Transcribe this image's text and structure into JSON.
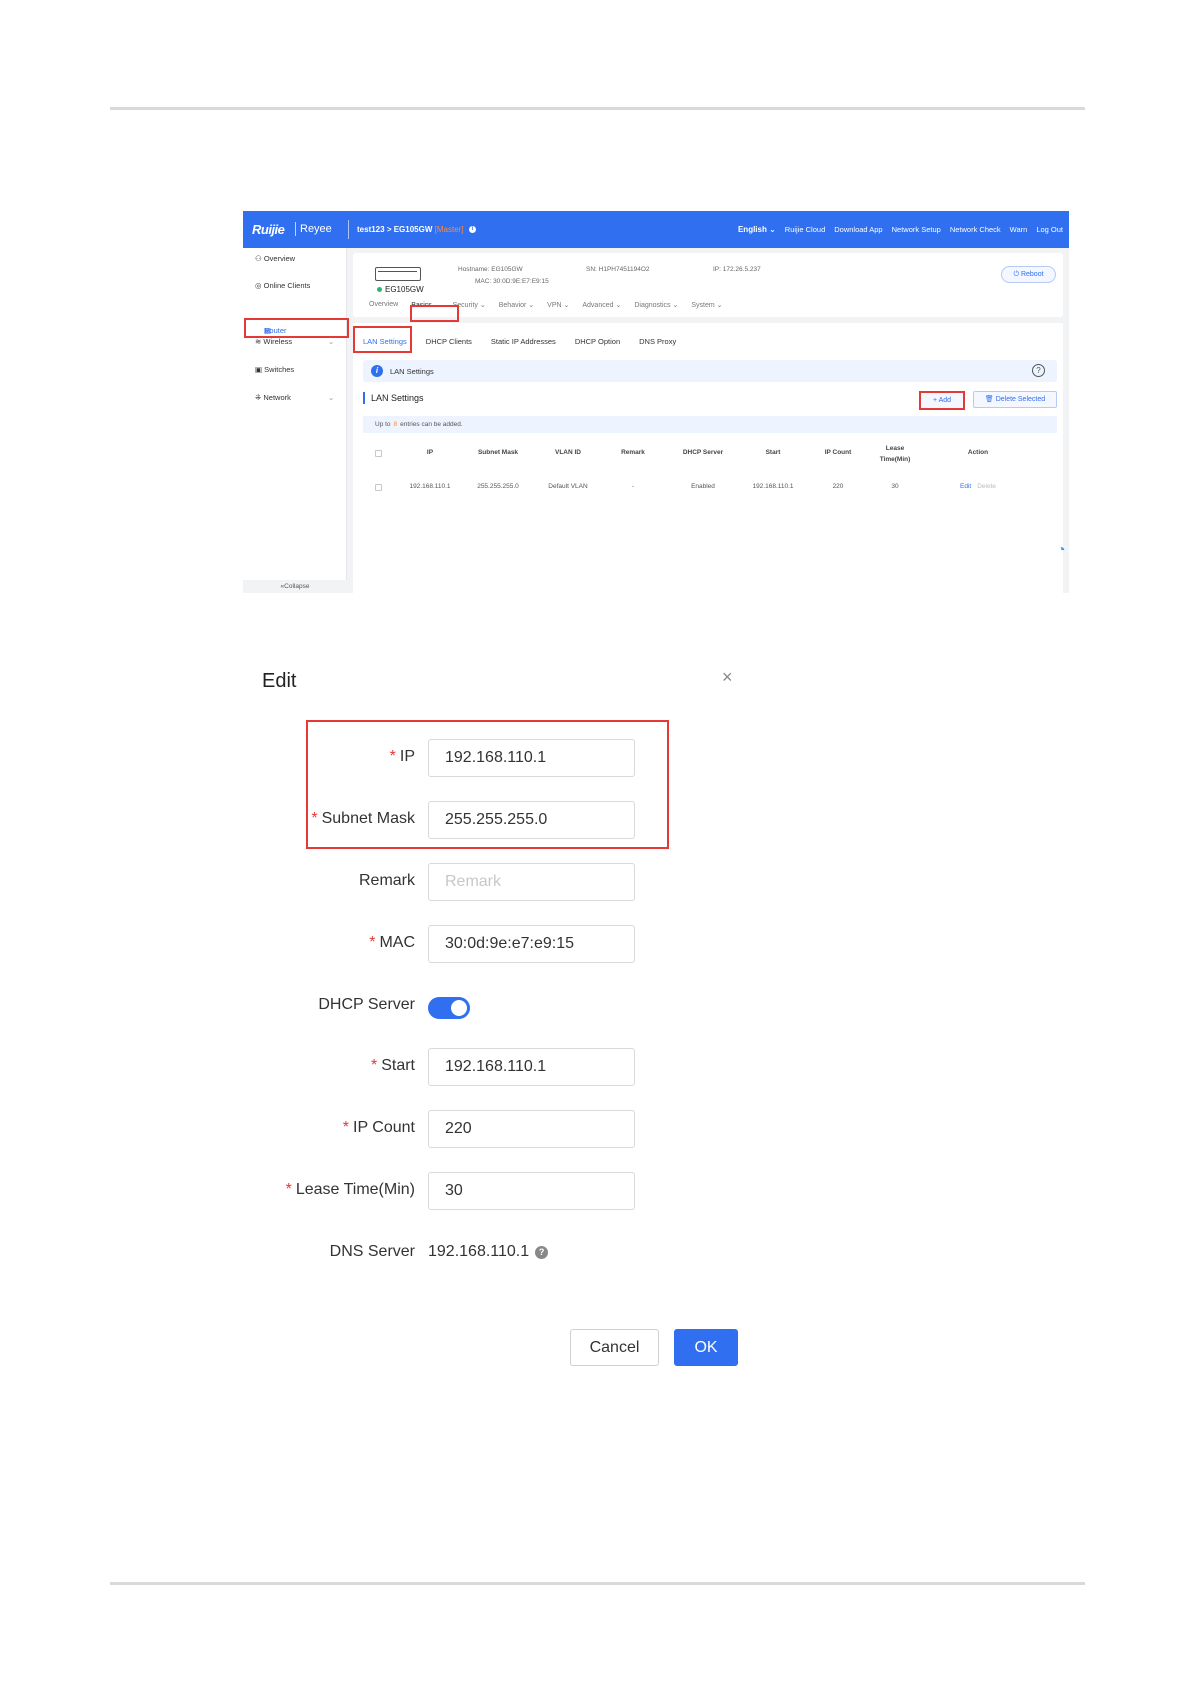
{
  "screen1": {
    "topbar": {
      "logo": "Ruijie",
      "logo_sub": "Reyee",
      "breadcrumb_project": "test123",
      "breadcrumb_sep": ">",
      "breadcrumb_device": "EG105GW",
      "master_tag": "[Master]",
      "nav": [
        "English ⌄",
        "Ruijie Cloud",
        "Download App",
        "Network Setup",
        "Network Check",
        "Warn",
        "Log Out"
      ]
    },
    "sidebar": {
      "items": [
        {
          "label": "Overview",
          "icon": "overview-icon"
        },
        {
          "label": "Online Clients",
          "icon": "clients-icon"
        },
        {
          "label": "Router",
          "icon": "router-icon"
        },
        {
          "label": "Wireless",
          "icon": "wifi-icon"
        },
        {
          "label": "Switches",
          "icon": "switch-icon"
        },
        {
          "label": "Network",
          "icon": "network-icon"
        }
      ],
      "collapse": "«Collapse"
    },
    "device": {
      "name": "EG105GW",
      "hostname_label": "Hostname:",
      "hostname": "EG105GW",
      "mac_label": "MAC:",
      "mac": "30:0D:9E:E7:E9:15",
      "sn_label": "SN:",
      "sn": "H1PH7451194O2",
      "ip_label": "IP:",
      "ip": "172.26.5.237",
      "reboot": "Reboot",
      "status_color": "#2bb673"
    },
    "subnav": [
      "Overview",
      "Basics ⌄",
      "Security ⌄",
      "Behavior ⌄",
      "VPN ⌄",
      "Advanced ⌄",
      "Diagnostics ⌄",
      "System ⌄"
    ],
    "tabs": [
      "LAN Settings",
      "DHCP Clients",
      "Static IP Addresses",
      "DHCP Option",
      "DNS Proxy"
    ],
    "info_bar": "LAN Settings",
    "section_title": "LAN Settings",
    "add_button": "+ Add",
    "delete_button": "Delete Selected",
    "upto": {
      "prefix": "Up to",
      "count": "8",
      "suffix": "entries can be added."
    },
    "table": {
      "headers": [
        "IP",
        "Subnet Mask",
        "VLAN ID",
        "Remark",
        "DHCP Server",
        "Start",
        "IP Count",
        "Lease Time(Min)",
        "Action"
      ],
      "rows": [
        {
          "ip": "192.168.110.1",
          "mask": "255.255.255.0",
          "vlan": "Default VLAN",
          "remark": "-",
          "dhcp": "Enabled",
          "start": "192.168.110.1",
          "count": "220",
          "lease": "30",
          "edit": "Edit",
          "delete": "Delete"
        }
      ]
    },
    "accent_color": "#2f6ff0",
    "highlight_color": "#e53935"
  },
  "dialog": {
    "title": "Edit",
    "close_icon": "×",
    "required_mark": "*",
    "fields": {
      "ip": {
        "label": "IP",
        "value": "192.168.110.1"
      },
      "subnet_mask": {
        "label": "Subnet Mask",
        "value": "255.255.255.0"
      },
      "remark": {
        "label": "Remark",
        "value": "",
        "placeholder": "Remark"
      },
      "mac": {
        "label": "MAC",
        "value": "30:0d:9e:e7:e9:15"
      },
      "dhcp_server": {
        "label": "DHCP Server",
        "enabled": true
      },
      "start": {
        "label": "Start",
        "value": "192.168.110.1"
      },
      "ip_count": {
        "label": "IP Count",
        "value": "220"
      },
      "lease_time": {
        "label": "Lease Time(Min)",
        "value": "30"
      },
      "dns_server": {
        "label": "DNS Server",
        "value": "192.168.110.1"
      }
    },
    "cancel": "Cancel",
    "ok": "OK"
  }
}
